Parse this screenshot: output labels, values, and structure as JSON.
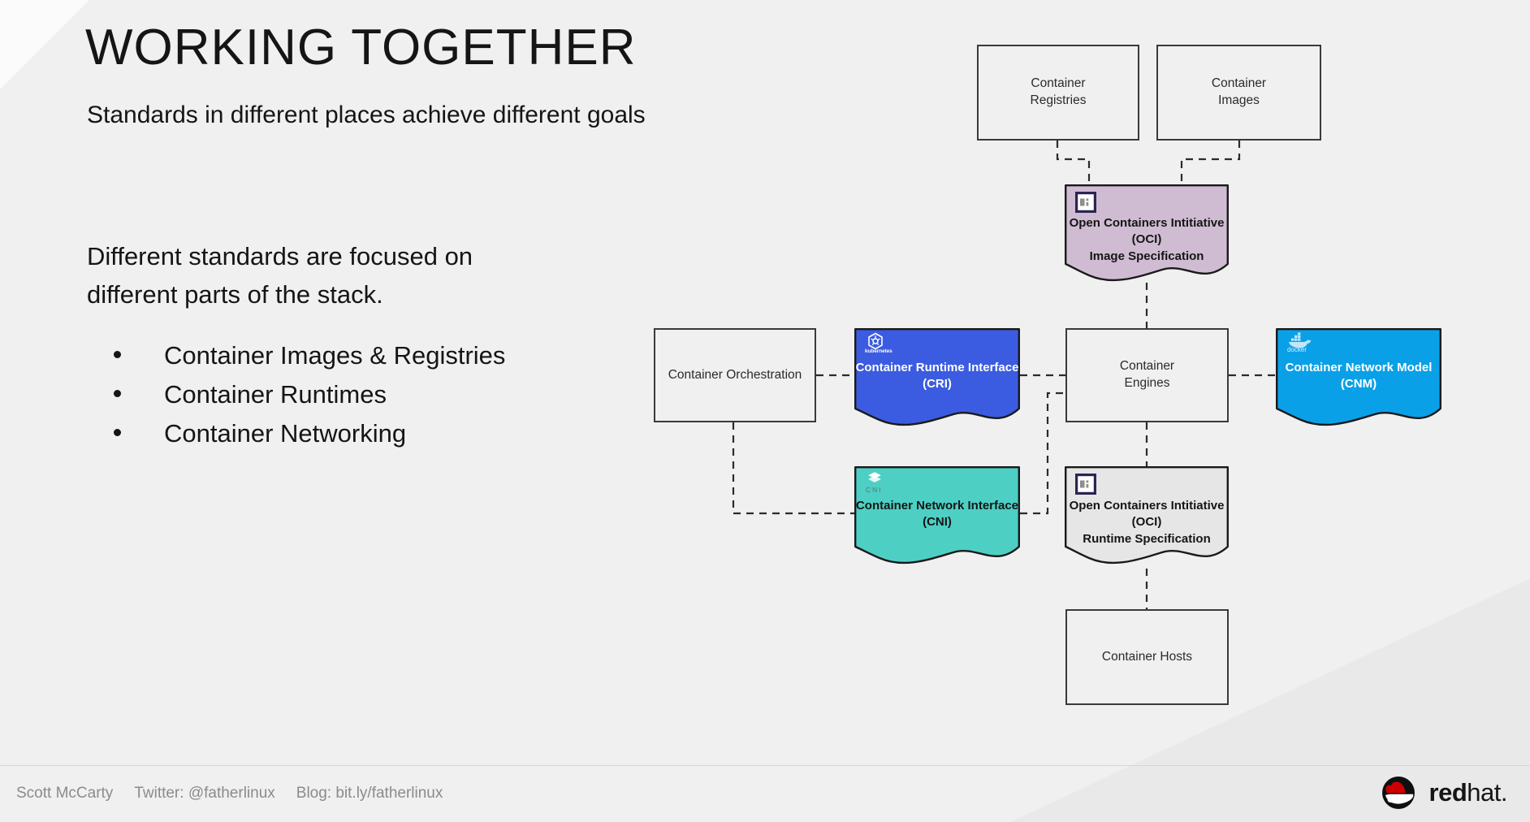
{
  "slide": {
    "title": "WORKING TOGETHER",
    "subtitle": "Standards in different places achieve different goals",
    "lead": "Different standards are focused on different parts of the stack.",
    "bullets": [
      "Container Images & Registries",
      "Container Runtimes",
      "Container Networking"
    ]
  },
  "footer": {
    "author": "Scott McCarty",
    "twitter": "Twitter: @fatherlinux",
    "blog": "Blog: bit.ly/fatherlinux",
    "brand_bold": "red",
    "brand_light": "hat."
  },
  "diagram": {
    "plain_boxes": [
      {
        "name": "container-registries",
        "label": "Container\nRegistries"
      },
      {
        "name": "container-images",
        "label": "Container\nImages"
      },
      {
        "name": "container-orchestration",
        "label": "Container Orchestration"
      },
      {
        "name": "container-engines",
        "label": "Container\nEngines"
      },
      {
        "name": "container-hosts",
        "label": "Container Hosts"
      }
    ],
    "spec_boxes": [
      {
        "name": "oci-image-specification",
        "line1": "Open Containers Intitiative (OCI)",
        "line2": "Image Specification",
        "fill": "#cfbcd2",
        "text_color": "#151515",
        "icon": "oci-logo-icon"
      },
      {
        "name": "container-runtime-interface",
        "line1": "Container Runtime Interface",
        "line2": "(CRI)",
        "fill": "#3b5ce0",
        "text_color": "#ffffff",
        "icon": "kubernetes-logo-icon",
        "icon_caption": "kubernetes"
      },
      {
        "name": "container-network-model",
        "line1": "Container Network Model",
        "line2": "(CNM)",
        "fill": "#0aa0e8",
        "text_color": "#ffffff",
        "icon": "docker-logo-icon",
        "icon_caption": "docker"
      },
      {
        "name": "container-network-interface",
        "line1": "Container Network Interface",
        "line2": "(CNI)",
        "fill": "#4ecfc4",
        "text_color": "#151515",
        "icon": "cni-logo-icon",
        "icon_caption": "CNI"
      },
      {
        "name": "oci-runtime-specification",
        "line1": "Open Containers Intitiative (OCI)",
        "line2": "Runtime Specification",
        "fill": "#e6e6e6",
        "text_color": "#151515",
        "icon": "oci-logo-icon"
      }
    ]
  },
  "colors": {
    "background": "#f0f0f0",
    "text": "#151515",
    "footer_text": "#8b8b8b",
    "stroke": "#3a3a3a",
    "redhat_red": "#cc0000"
  }
}
